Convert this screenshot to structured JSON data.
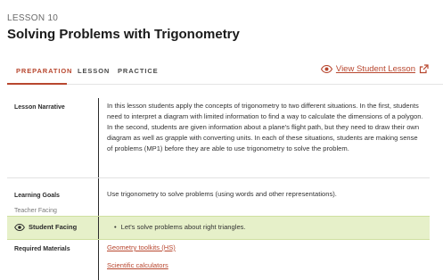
{
  "lesson": {
    "number_label": "LESSON 10",
    "title": "Solving Problems with Trigonometry"
  },
  "tabs": [
    {
      "label": "PREPARATION",
      "active": true
    },
    {
      "label": "LESSON",
      "active": false
    },
    {
      "label": "PRACTICE",
      "active": false
    }
  ],
  "view_student_lesson": {
    "label": "View Student Lesson",
    "icon": "eye-icon",
    "trailing_icon": "external-link-icon"
  },
  "rows": {
    "narrative": {
      "label": "Lesson Narrative",
      "text": "In this lesson students apply the concepts of trigonometry to two different situations. In the first, students need to interpret a diagram with limited information to find a way to calculate the dimensions of a polygon. In the second, students are given information about a plane's flight path, but they need to draw their own diagram as well as grapple with converting units. In each of these situations, students are making sense of problems (MP1) before they are able to use trigonometry to solve the problem."
    },
    "goals": {
      "label": "Learning Goals",
      "sublabel": "Teacher Facing",
      "text": "Use trigonometry to solve problems (using words and other representations)."
    },
    "student_facing": {
      "label": "Student Facing",
      "icon": "eye-icon",
      "items": [
        "Let's solve problems about right triangles."
      ]
    },
    "materials": {
      "label": "Required Materials",
      "links": [
        "Geometry toolkits (HS)",
        "Scientific calculators"
      ]
    }
  },
  "colors": {
    "accent": "#b8472f",
    "student_facing_bg": "#e6f0c9"
  }
}
